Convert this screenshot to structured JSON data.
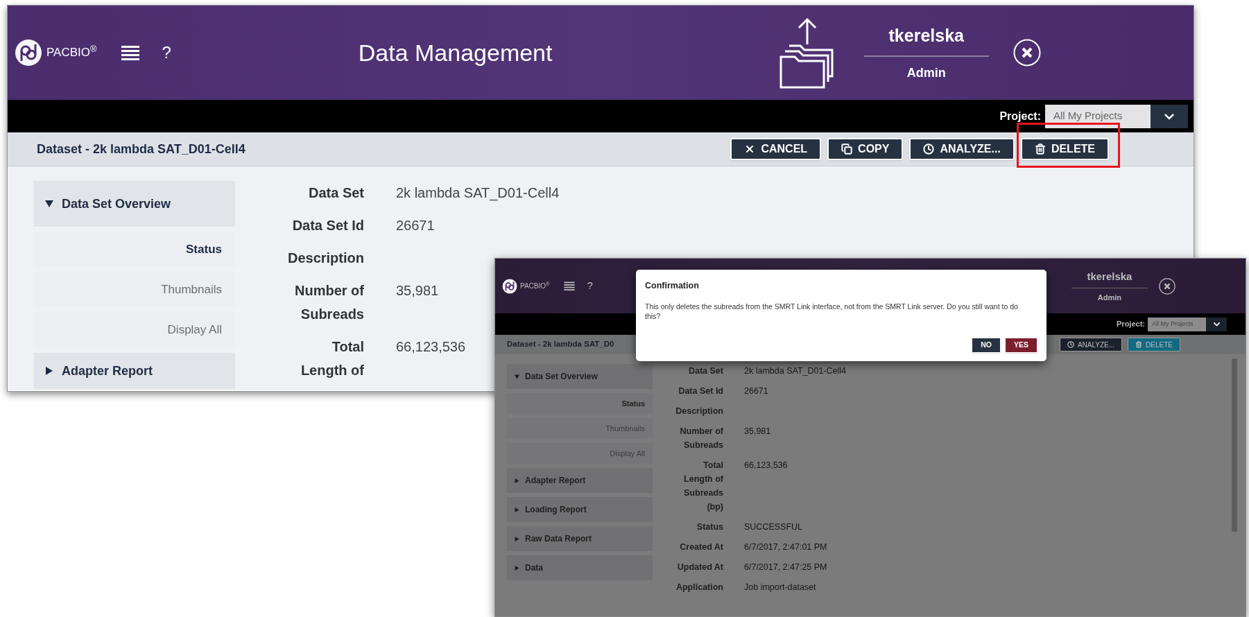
{
  "main_screen": {
    "header": {
      "logo": "PACBIO$^{®}$",
      "help": "?",
      "title": "Data Management",
      "user": "tkerelska",
      "role": "Admin"
    },
    "project": {
      "label": "Project:",
      "value": "All My Projects"
    },
    "dataset_title": "Dataset - 2k lambda SAT_D01-Cell4",
    "actions": [
      {
        "label": "CANCEL",
        "kind": "cancel",
        "active": false,
        "annotated": false
      },
      {
        "label": "COPY",
        "kind": "copy",
        "active": false,
        "annotated": false
      },
      {
        "label": "ANALYZE...",
        "kind": "analyze",
        "active": false,
        "annotated": false
      },
      {
        "label": "DELETE",
        "kind": "delete",
        "active": false,
        "annotated": true
      }
    ],
    "sidebar": [
      {
        "kind": "section",
        "label": "Data Set Overview",
        "expanded": true
      },
      {
        "kind": "link",
        "label": "Status",
        "selected": true
      },
      {
        "kind": "link",
        "label": "Thumbnails",
        "selected": false
      },
      {
        "kind": "link",
        "label": "Display All",
        "selected": false
      },
      {
        "kind": "section",
        "label": "Adapter Report",
        "expanded": false
      }
    ],
    "fields": [
      {
        "label_lines": [
          "Data Set"
        ],
        "value": "2k lambda SAT_D01-Cell4"
      },
      {
        "label_lines": [
          "Data Set Id"
        ],
        "value": "26671"
      },
      {
        "label_lines": [
          "Description"
        ]
      },
      {
        "label_lines": [
          "Number of",
          "Subreads"
        ],
        "value": "35,981"
      },
      {
        "label_lines": [
          "Total",
          "Length of"
        ],
        "value": "66,123,536"
      }
    ]
  },
  "dialog_screen": {
    "header": {
      "logo": "PACBIO$^{®}$",
      "help": "?",
      "user": "tkerelska",
      "role": "Admin"
    },
    "project": {
      "label": "Project:",
      "value": "All My Projects"
    },
    "dataset_title": "Dataset - 2k lambda SAT_D0",
    "actions": [
      {
        "label": "ANALYZE...",
        "kind": "analyze",
        "active": false,
        "annotated": false
      },
      {
        "label": "DELETE",
        "kind": "delete",
        "active": true,
        "annotated": false
      }
    ],
    "sidebar": [
      {
        "kind": "section",
        "label": "Data Set Overview",
        "expanded": true
      },
      {
        "kind": "link",
        "label": "Status",
        "selected": true
      },
      {
        "kind": "link",
        "label": "Thumbnails",
        "selected": false
      },
      {
        "kind": "link",
        "label": "Display All",
        "selected": false
      },
      {
        "kind": "section",
        "label": "Adapter Report",
        "expanded": false
      },
      {
        "kind": "section",
        "label": "Loading Report",
        "expanded": false
      },
      {
        "kind": "section",
        "label": "Raw Data Report",
        "expanded": false
      },
      {
        "kind": "section",
        "label": "Data",
        "expanded": false
      }
    ],
    "fields": [
      {
        "label_lines": [
          "Data Set"
        ],
        "value": "2k lambda SAT_D01-Cell4"
      },
      {
        "label_lines": [
          "Data Set Id"
        ],
        "value": "26671"
      },
      {
        "label_lines": [
          "Description"
        ]
      },
      {
        "label_lines": [
          "Number of",
          "Subreads"
        ],
        "value": "35,981"
      },
      {
        "label_lines": [
          "Total",
          "Length of",
          "Subreads",
          "(bp)"
        ],
        "value": "66,123,536"
      },
      {
        "label_lines": [
          "Status"
        ],
        "value": "SUCCESSFUL"
      },
      {
        "label_lines": [
          "Created At"
        ],
        "value": "6/7/2017, 2:47:01 PM"
      },
      {
        "label_lines": [
          "Updated At"
        ],
        "value": "6/7/2017, 2:47:25 PM"
      },
      {
        "label_lines": [
          "Application"
        ],
        "value": "Job import-dataset"
      }
    ],
    "dialog": {
      "title": "Confirmation",
      "message": "This only deletes the subreads from the SMRT Link interface, not from the SMRT Link server. Do you still want to do this?",
      "buttons": [
        {
          "label": "NO",
          "kind": "secondary"
        },
        {
          "label": "YES",
          "kind": "primary"
        }
      ]
    }
  }
}
